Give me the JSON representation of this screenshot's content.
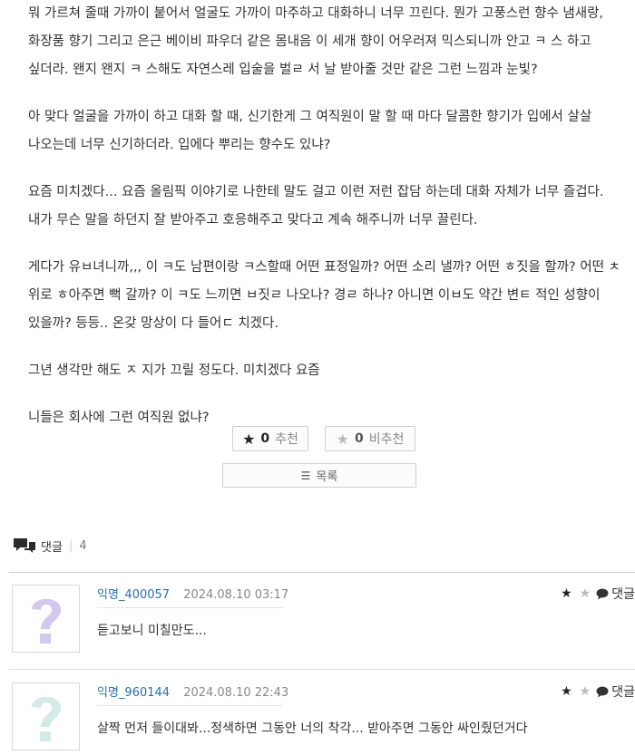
{
  "post": {
    "paragraphs": [
      "뭐 가르쳐 줄때 가까이 붙어서 얼굴도 가까이 마주하고 대화하니 너무 끄린다. 뭔가 고풍스런 향수 냄새랑, 화장품 향기 그리고 은근 베이비 파우더 같은 몸내음 이 세개 향이 어우러져 믹스되니까 안고 ㅋ 스 하고 싶더라. 왠지 왠지 ㅋ 스해도 자연스레 입술을 벌ㄹ 서 날 받아줄 것만 같은 그런 느낌과 눈빛?",
      "아 맞다 얼굴을 가까이 하고 대화 할 때, 신기한게 그 여직원이 말 할 때 마다 달콤한 향기가 입에서 살살 나오는데 너무 신기하더라. 입에다 뿌리는 향수도 있냐?",
      "요즘 미치겠다... 요즘 올림픽 이야기로 나한테 말도 걸고 이런 저런 잡담 하는데 대화 자체가 너무 즐겁다. 내가 무슨 말을 하던지 잘 받아주고 호응해주고 맞다고 계속 해주니까 너무 끌린다.",
      "게다가 유ㅂ녀니까,,, 이 ㅋ도 남편이랑 ㅋ스할때 어떤 표정일까? 어떤 소리 낼까? 어떤 ㅎ짓을 할까? 어떤 ㅊ 위로 ㅎ아주면 뻑 갈까? 이 ㅋ도 느끼면 ㅂ짓ㄹ 나오나? 경ㄹ 하나? 아니면 이ㅂ도 약간 변ㅌ 적인 성향이 있을까? 등등.. 온갖 망상이 다 들어ㄷ 치겠다.",
      "그년 생각만 해도 ㅈ 지가 끄릴 정도다. 미치겠다 요즘",
      "니들은 회사에 그런 여직원 없냐?"
    ]
  },
  "votes": {
    "upvote_icon": "star-filled-icon",
    "upvote_count": "0",
    "upvote_label": "추천",
    "downvote_icon": "star-outline-icon",
    "downvote_count": "0",
    "downvote_label": "비추천"
  },
  "list_button": {
    "icon": "list-icon",
    "label": "목록"
  },
  "comments_section": {
    "icon": "comment-bubbles-icon",
    "title": "댓글",
    "count": "4"
  },
  "comments": [
    {
      "author": "익명_400057",
      "date": "2024.08.10 03:17",
      "text": "듣고보니 미칠만도...",
      "reply_label": "댓글",
      "avatar_color": "#d3c8ee"
    },
    {
      "author": "익명_960144",
      "date": "2024.08.10 22:43",
      "text": "살짝 먼저 들이대봐...정색하면 그동안 너의 착각... 받아주면 그동안 싸인줬던거다",
      "reply_label": "댓글",
      "avatar_color": "#d3ebe6"
    }
  ],
  "colors": {
    "author_link": "#2a6fa8",
    "avatar_a": "#d3c8ee",
    "avatar_b": "#d3ebe6"
  }
}
